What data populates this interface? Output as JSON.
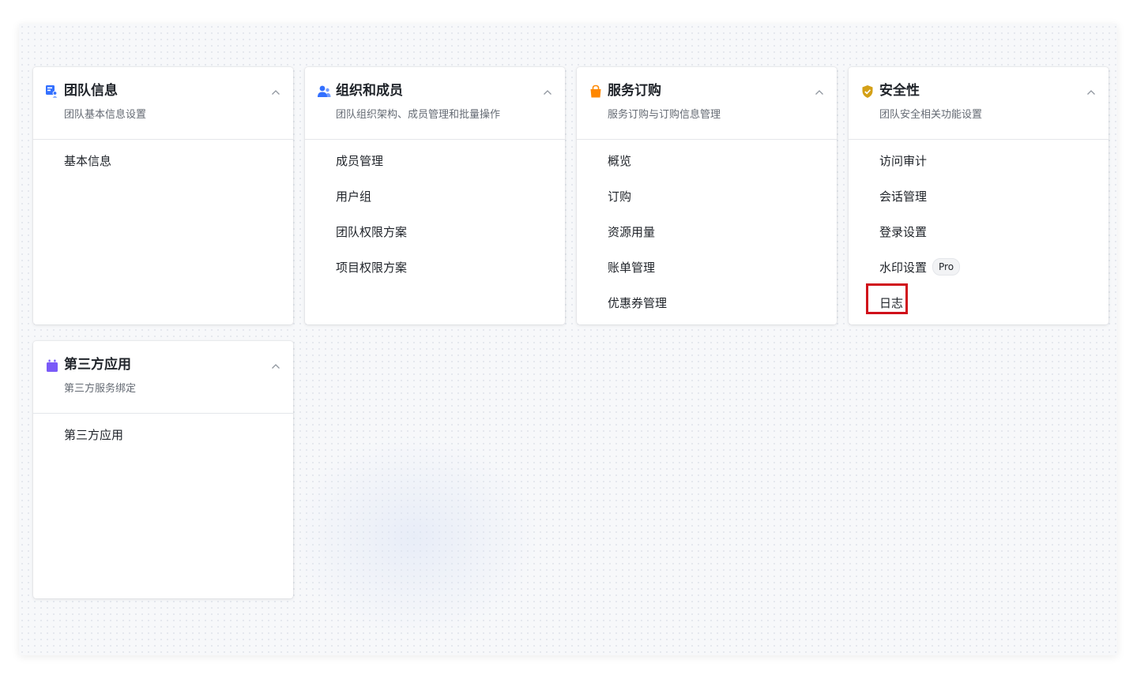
{
  "colors": {
    "team_icon": "#3370ff",
    "org_icon": "#3370ff",
    "service_icon": "#ff8800",
    "security_icon": "#d4a017",
    "thirdparty_icon": "#7a5af8",
    "highlight_border": "#d0101a"
  },
  "cards": {
    "team": {
      "icon": "team-info-icon",
      "title": "团队信息",
      "subtitle": "团队基本信息设置",
      "items": [
        "基本信息"
      ]
    },
    "org": {
      "icon": "org-members-icon",
      "title": "组织和成员",
      "subtitle": "团队组织架构、成员管理和批量操作",
      "items": [
        "成员管理",
        "用户组",
        "团队权限方案",
        "项目权限方案"
      ]
    },
    "service": {
      "icon": "shopping-bag-icon",
      "title": "服务订购",
      "subtitle": "服务订购与订购信息管理",
      "items": [
        "概览",
        "订购",
        "资源用量",
        "账单管理",
        "优惠券管理"
      ]
    },
    "security": {
      "icon": "shield-check-icon",
      "title": "安全性",
      "subtitle": "团队安全相关功能设置",
      "items": [
        "访问审计",
        "会话管理",
        "登录设置",
        "水印设置",
        "日志"
      ],
      "pro_badge": "Pro",
      "highlighted_item": "日志"
    },
    "thirdparty": {
      "icon": "app-icon",
      "title": "第三方应用",
      "subtitle": "第三方服务绑定",
      "items": [
        "第三方应用"
      ]
    }
  }
}
